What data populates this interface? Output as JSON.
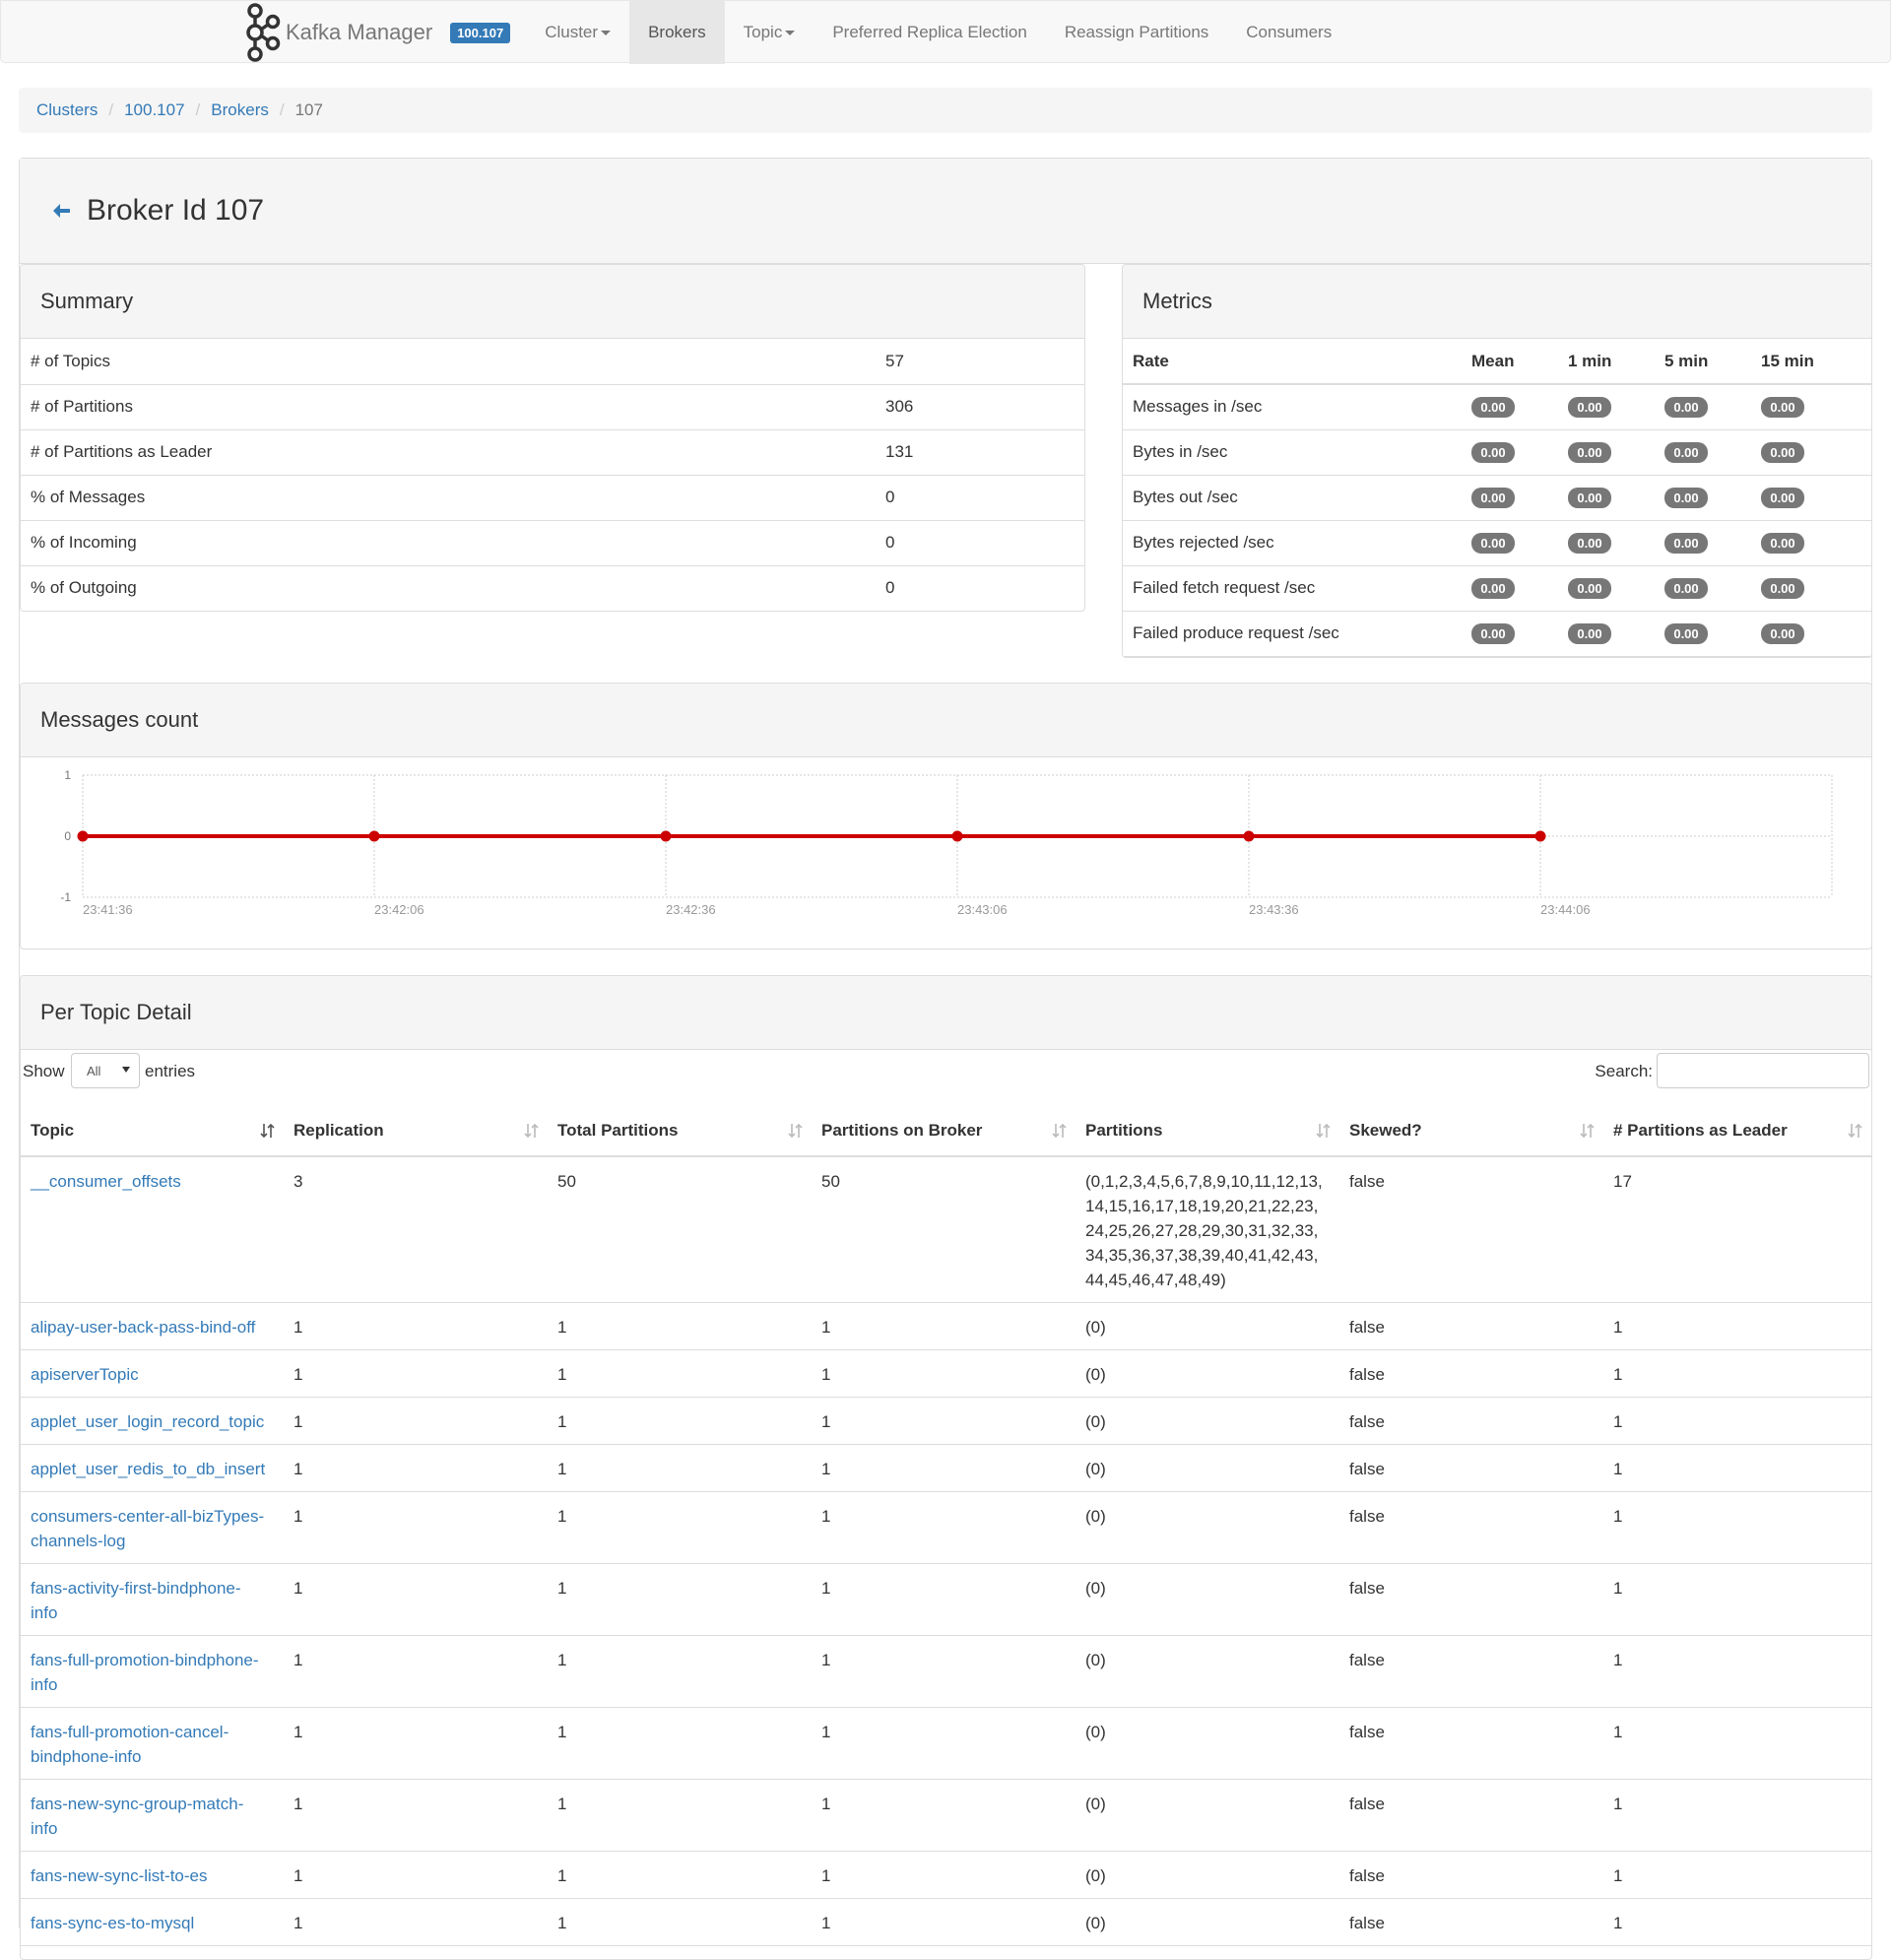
{
  "nav": {
    "brand": "Kafka Manager",
    "cluster_badge": "100.107",
    "items": [
      {
        "label": "Cluster",
        "dropdown": true,
        "active": false
      },
      {
        "label": "Brokers",
        "dropdown": false,
        "active": true
      },
      {
        "label": "Topic",
        "dropdown": true,
        "active": false
      },
      {
        "label": "Preferred Replica Election",
        "dropdown": false,
        "active": false
      },
      {
        "label": "Reassign Partitions",
        "dropdown": false,
        "active": false
      },
      {
        "label": "Consumers",
        "dropdown": false,
        "active": false
      }
    ]
  },
  "breadcrumb": {
    "clusters": "Clusters",
    "cluster": "100.107",
    "brokers": "Brokers",
    "current": "107"
  },
  "page": {
    "title": "Broker Id 107"
  },
  "summary": {
    "title": "Summary",
    "rows": [
      {
        "label": "# of Topics",
        "value": "57"
      },
      {
        "label": "# of Partitions",
        "value": "306"
      },
      {
        "label": "# of Partitions as Leader",
        "value": "131"
      },
      {
        "label": "% of Messages",
        "value": "0"
      },
      {
        "label": "% of Incoming",
        "value": "0"
      },
      {
        "label": "% of Outgoing",
        "value": "0"
      }
    ]
  },
  "metrics": {
    "title": "Metrics",
    "headers": [
      "Rate",
      "Mean",
      "1 min",
      "5 min",
      "15 min"
    ],
    "rows": [
      {
        "label": "Messages in /sec",
        "mean": "0.00",
        "m1": "0.00",
        "m5": "0.00",
        "m15": "0.00"
      },
      {
        "label": "Bytes in /sec",
        "mean": "0.00",
        "m1": "0.00",
        "m5": "0.00",
        "m15": "0.00"
      },
      {
        "label": "Bytes out /sec",
        "mean": "0.00",
        "m1": "0.00",
        "m5": "0.00",
        "m15": "0.00"
      },
      {
        "label": "Bytes rejected /sec",
        "mean": "0.00",
        "m1": "0.00",
        "m5": "0.00",
        "m15": "0.00"
      },
      {
        "label": "Failed fetch request /sec",
        "mean": "0.00",
        "m1": "0.00",
        "m5": "0.00",
        "m15": "0.00"
      },
      {
        "label": "Failed produce request /sec",
        "mean": "0.00",
        "m1": "0.00",
        "m5": "0.00",
        "m15": "0.00"
      }
    ]
  },
  "messages_count": {
    "title": "Messages count",
    "line_color": "#cc0000"
  },
  "chart_data": {
    "type": "line",
    "x": [
      "23:41:36",
      "23:42:06",
      "23:42:36",
      "23:43:06",
      "23:43:36",
      "23:44:06"
    ],
    "series": [
      {
        "values": [
          0,
          0,
          0,
          0,
          0,
          0
        ]
      }
    ],
    "yticks": [
      "1",
      "0",
      "-1"
    ],
    "ylim": [
      -1,
      1
    ],
    "grid": true,
    "title": "",
    "xlabel": "",
    "ylabel": ""
  },
  "per_topic": {
    "title": "Per Topic Detail",
    "show_label": "Show",
    "show_value": "All",
    "entries_label": "entries",
    "search_label": "Search:",
    "headers": [
      "Topic",
      "Replication",
      "Total Partitions",
      "Partitions on Broker",
      "Partitions",
      "Skewed?",
      "# Partitions as Leader"
    ],
    "rows": [
      {
        "topic": "__consumer_offsets",
        "replication": "3",
        "total": "50",
        "on_broker": "50",
        "partitions": "(0,1,2,3,4,5,6,7,8,9,10,11,12,13,\n14,15,16,17,18,19,20,21,22,23,\n24,25,26,27,28,29,30,31,32,33,\n34,35,36,37,38,39,40,41,42,43,\n44,45,46,47,48,49)",
        "skewed": "false",
        "leader": "17"
      },
      {
        "topic": "alipay-user-back-pass-bind-off",
        "replication": "1",
        "total": "1",
        "on_broker": "1",
        "partitions": "(0)",
        "skewed": "false",
        "leader": "1"
      },
      {
        "topic": "apiserverTopic",
        "replication": "1",
        "total": "1",
        "on_broker": "1",
        "partitions": "(0)",
        "skewed": "false",
        "leader": "1"
      },
      {
        "topic": "applet_user_login_record_topic",
        "replication": "1",
        "total": "1",
        "on_broker": "1",
        "partitions": "(0)",
        "skewed": "false",
        "leader": "1"
      },
      {
        "topic": "applet_user_redis_to_db_insert",
        "replication": "1",
        "total": "1",
        "on_broker": "1",
        "partitions": "(0)",
        "skewed": "false",
        "leader": "1"
      },
      {
        "topic": "consumers-center-all-bizTypes-\nchannels-log",
        "replication": "1",
        "total": "1",
        "on_broker": "1",
        "partitions": "(0)",
        "skewed": "false",
        "leader": "1"
      },
      {
        "topic": "fans-activity-first-bindphone-\ninfo",
        "replication": "1",
        "total": "1",
        "on_broker": "1",
        "partitions": "(0)",
        "skewed": "false",
        "leader": "1"
      },
      {
        "topic": "fans-full-promotion-bindphone-\ninfo",
        "replication": "1",
        "total": "1",
        "on_broker": "1",
        "partitions": "(0)",
        "skewed": "false",
        "leader": "1"
      },
      {
        "topic": "fans-full-promotion-cancel-\nbindphone-info",
        "replication": "1",
        "total": "1",
        "on_broker": "1",
        "partitions": "(0)",
        "skewed": "false",
        "leader": "1"
      },
      {
        "topic": "fans-new-sync-group-match-\ninfo",
        "replication": "1",
        "total": "1",
        "on_broker": "1",
        "partitions": "(0)",
        "skewed": "false",
        "leader": "1"
      },
      {
        "topic": "fans-new-sync-list-to-es",
        "replication": "1",
        "total": "1",
        "on_broker": "1",
        "partitions": "(0)",
        "skewed": "false",
        "leader": "1"
      },
      {
        "topic": "fans-sync-es-to-mysql",
        "replication": "1",
        "total": "1",
        "on_broker": "1",
        "partitions": "(0)",
        "skewed": "false",
        "leader": "1"
      }
    ]
  }
}
